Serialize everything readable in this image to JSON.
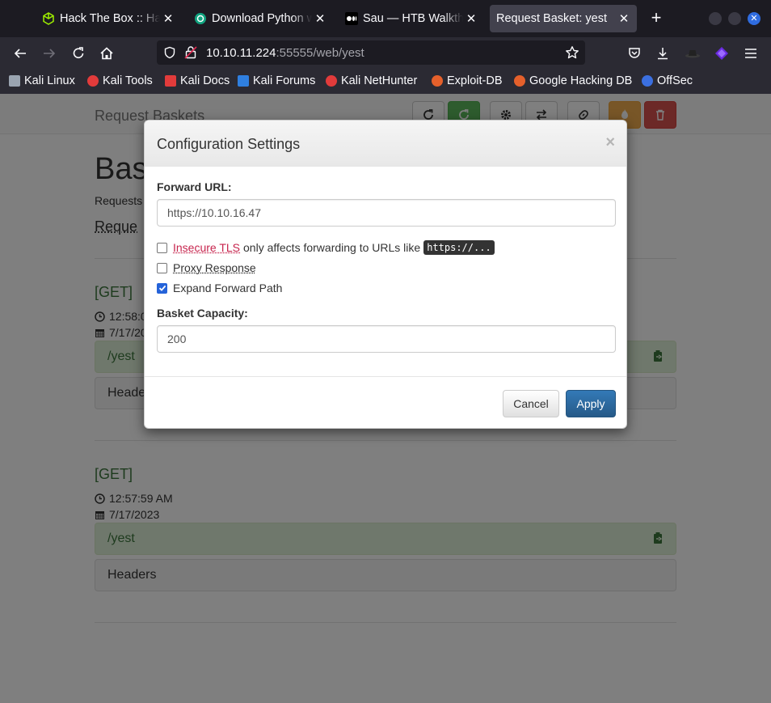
{
  "browser": {
    "tabs": [
      {
        "label": "Hack The Box :: Hack The Box",
        "icon": "htb-cube-icon",
        "active": false
      },
      {
        "label": "Download Python with ChatGPT",
        "icon": "openai-icon",
        "active": false
      },
      {
        "label": "Sau — HTB Walkthrough",
        "icon": "medium-icon",
        "active": false
      },
      {
        "label": "Request Basket: yest",
        "icon": "",
        "active": true
      }
    ],
    "url_host": "10.10.11.224",
    "url_rest": ":55555/web/yest",
    "bookmarks": [
      {
        "label": "Kali Linux",
        "color": "#9aa4b1"
      },
      {
        "label": "Kali Tools",
        "color": "#e23b3b"
      },
      {
        "label": "Kali Docs",
        "color": "#e23b3b"
      },
      {
        "label": "Kali Forums",
        "color": "#2f7fe0"
      },
      {
        "label": "Kali NetHunter",
        "color": "#e23b3b"
      },
      {
        "label": "Exploit-DB",
        "color": "#e5602b"
      },
      {
        "label": "Google Hacking DB",
        "color": "#e5602b"
      },
      {
        "label": "OffSec",
        "color": "#3b6fe0"
      }
    ]
  },
  "app": {
    "brand": "Request Baskets",
    "title": "Bas",
    "subtitle": "Requests",
    "link": "Reque",
    "requests": [
      {
        "method": "[GET]",
        "time": "12:58:0",
        "date": "7/17/20",
        "path": "/yest",
        "headers_label": "Heade"
      },
      {
        "method": "[GET]",
        "time": "12:57:59 AM",
        "date": "7/17/2023",
        "path": "/yest",
        "headers_label": "Headers"
      }
    ]
  },
  "modal": {
    "title": "Configuration Settings",
    "close": "×",
    "forward_url_label": "Forward URL:",
    "forward_url_value": "https://10.10.16.47",
    "insecure_tls_label": "Insecure TLS",
    "insecure_tls_note": "only affects forwarding to URLs like",
    "insecure_tls_code": "https://...",
    "insecure_tls_checked": false,
    "proxy_response_label": "Proxy Response",
    "proxy_response_checked": false,
    "expand_path_label": "Expand Forward Path",
    "expand_path_checked": true,
    "capacity_label": "Basket Capacity:",
    "capacity_value": "200",
    "cancel_label": "Cancel",
    "apply_label": "Apply"
  }
}
